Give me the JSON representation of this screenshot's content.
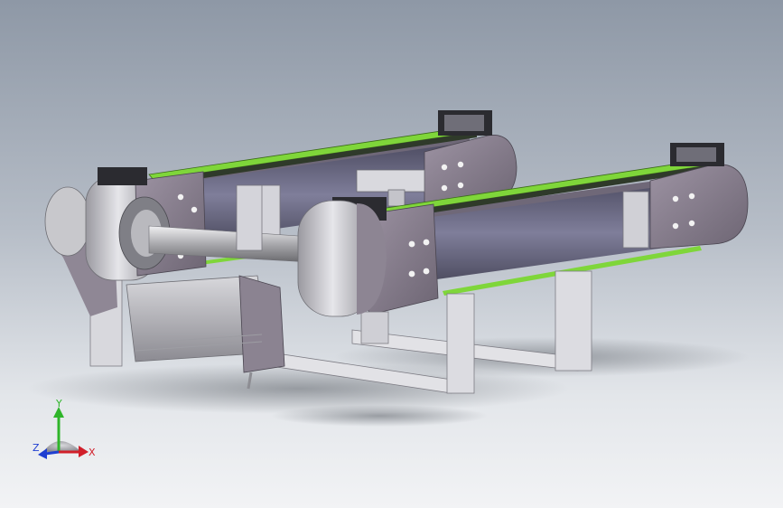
{
  "viewport": {
    "background_top": "#8e98a6",
    "background_bottom": "#f2f3f5"
  },
  "model": {
    "belt_color": "#7fd63a",
    "body_color": "#8a8290",
    "rail_color": "#6c6b84",
    "metal_color": "#c9c9cd"
  },
  "triad": {
    "x_label": "X",
    "y_label": "Y",
    "z_label": "Z",
    "x_color": "#d11f2a",
    "y_color": "#2fb52a",
    "z_color": "#1f3fd1"
  }
}
